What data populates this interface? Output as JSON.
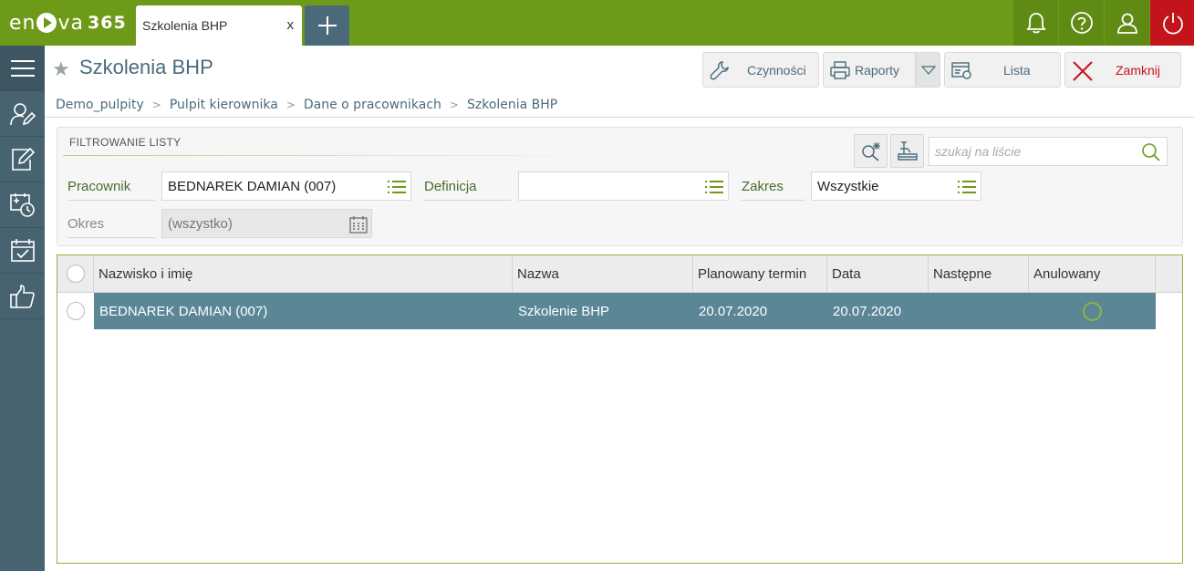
{
  "app": {
    "logo_text_left": "en",
    "logo_text_right": "va",
    "logo_number": "365",
    "active_tab": "Szkolenia BHP",
    "tab_close": "x",
    "add_tab_icon": "plus-icon",
    "brand_color": "#6e9a1a",
    "power_color": "#c3141b"
  },
  "top_icons": [
    "bell-icon",
    "help-icon",
    "user-icon",
    "power-icon"
  ],
  "sidebar": {
    "items": [
      "menu-icon",
      "user-edit-icon",
      "edit-icon",
      "schedule-icon",
      "calendar-check-icon",
      "thumbs-up-icon"
    ]
  },
  "header": {
    "title": "Szkolenia BHP",
    "favorite_icon": "star-icon"
  },
  "toolbar": {
    "czynnosci": "Czynności",
    "raporty": "Raporty",
    "lista": "Lista",
    "zamknij": "Zamknij"
  },
  "breadcrumb": [
    "Demo_pulpity",
    "Pulpit kierownika",
    "Dane o pracownikach",
    "Szkolenia BHP"
  ],
  "filter": {
    "title": "FILTROWANIE LISTY",
    "search_placeholder": "szukaj na liście",
    "pracownik_label": "Pracownik",
    "pracownik_value": "BEDNAREK DAMIAN (007)",
    "definicja_label": "Definicja",
    "definicja_value": "",
    "zakres_label": "Zakres",
    "zakres_value": "Wszystkie",
    "okres_label": "Okres",
    "okres_value": "(wszystko)"
  },
  "grid": {
    "columns": [
      "Nazwisko i imię",
      "Nazwa",
      "Planowany termin",
      "Data",
      "Następne",
      "Anulowany"
    ],
    "rows": [
      {
        "nazwisko": "BEDNAREK DAMIAN (007)",
        "nazwa": "Szkolenie BHP",
        "planowany": "20.07.2020",
        "data": "20.07.2020",
        "nastepne": "",
        "anulowany": false
      }
    ]
  }
}
